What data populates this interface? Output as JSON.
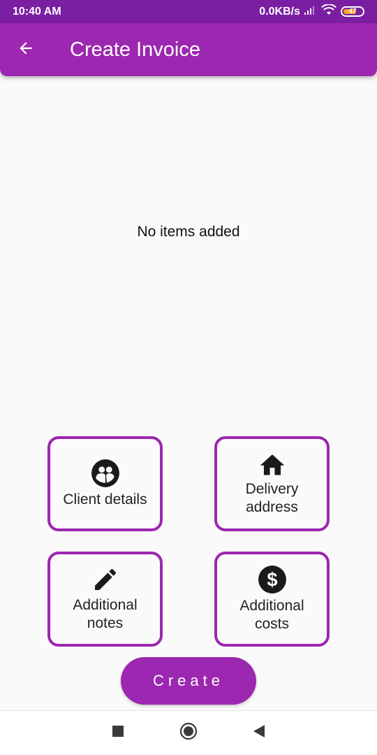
{
  "status_bar": {
    "time": "10:40 AM",
    "network_speed": "0.0KB/s",
    "battery_level": "47",
    "icons": [
      "signal-icon",
      "wifi-icon",
      "battery-icon"
    ]
  },
  "app_bar": {
    "title": "Create Invoice",
    "back_icon": "arrow-back-icon",
    "color": "#9c27b0"
  },
  "main": {
    "empty_message": "No items added"
  },
  "cards": [
    {
      "label": "Client details",
      "icon": "client-icon"
    },
    {
      "label": "Delivery\naddress",
      "icon": "home-icon"
    },
    {
      "label": "Additional\nnotes",
      "icon": "pencil-icon"
    },
    {
      "label": "Additional\ncosts",
      "icon": "dollar-icon"
    }
  ],
  "create_button": {
    "label": "Create"
  },
  "nav_bar": {
    "icons": [
      "recents-icon",
      "home-circle-icon",
      "back-triangle-icon"
    ]
  },
  "colors": {
    "accent": "#9c27b0",
    "status_bar": "#7b1fa2",
    "background": "#fafafa"
  }
}
